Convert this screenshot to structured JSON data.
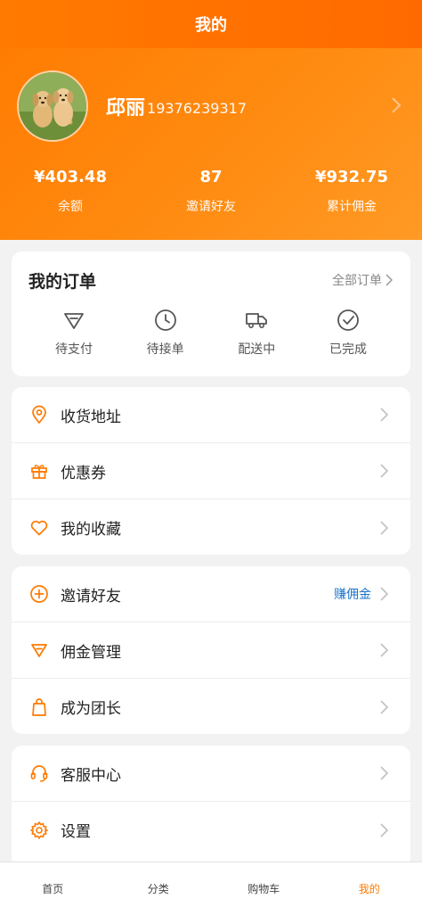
{
  "header": {
    "title": "我的"
  },
  "profile": {
    "name": "邱丽",
    "phone": "19376239317"
  },
  "stats": [
    {
      "value": "¥403.48",
      "label": "余额"
    },
    {
      "value": "87",
      "label": "邀请好友"
    },
    {
      "value": "¥932.75",
      "label": "累计佣金"
    }
  ],
  "orders": {
    "title": "我的订单",
    "view_all": "全部订单",
    "items": [
      {
        "label": "待支付",
        "icon": "gem-icon"
      },
      {
        "label": "待接单",
        "icon": "clock-icon"
      },
      {
        "label": "配送中",
        "icon": "truck-icon"
      },
      {
        "label": "已完成",
        "icon": "check-circle-icon"
      }
    ]
  },
  "menu_group_1": [
    {
      "label": "收货地址",
      "icon": "location-pin-icon"
    },
    {
      "label": "优惠券",
      "icon": "gift-icon"
    },
    {
      "label": "我的收藏",
      "icon": "heart-icon"
    }
  ],
  "menu_group_2": [
    {
      "label": "邀请好友",
      "icon": "plus-circle-icon",
      "hint": "赚佣金"
    },
    {
      "label": "佣金管理",
      "icon": "gem-icon"
    },
    {
      "label": "成为团长",
      "icon": "shopping-bag-icon"
    }
  ],
  "menu_group_3": [
    {
      "label": "客服中心",
      "icon": "headset-icon"
    },
    {
      "label": "设置",
      "icon": "gear-icon"
    }
  ],
  "tabbar": {
    "items": [
      {
        "label": "首页"
      },
      {
        "label": "分类"
      },
      {
        "label": "购物车"
      },
      {
        "label": "我的"
      }
    ],
    "active_index": 3
  },
  "colors": {
    "accent": "#ff7a00",
    "link": "#1a73c8"
  }
}
